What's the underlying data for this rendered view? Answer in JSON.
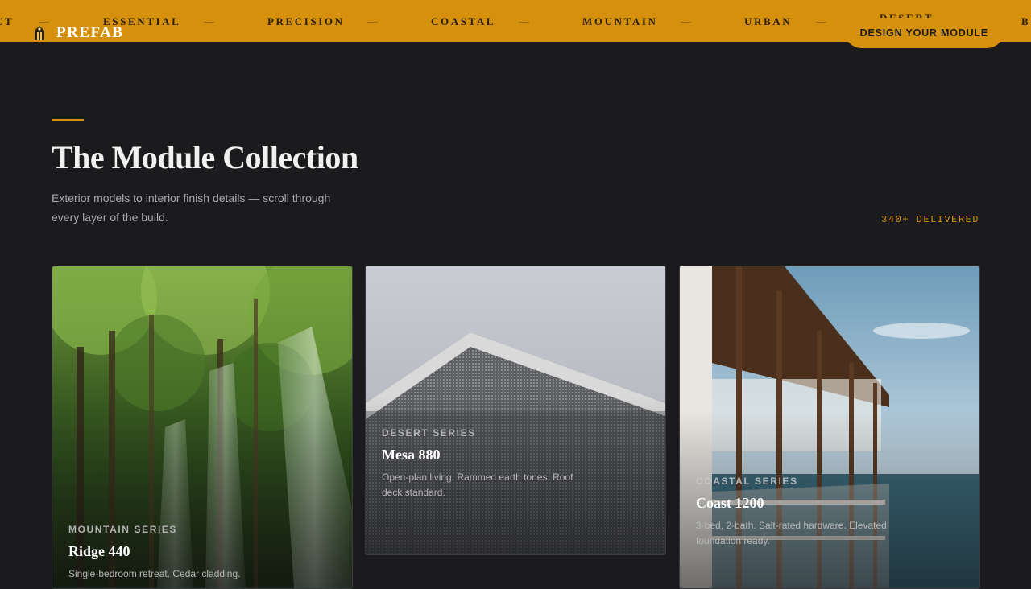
{
  "ticker": {
    "words": [
      "CT",
      "ESSENTIAL",
      "PRECISION",
      "COASTAL",
      "MOUNTAIN",
      "URBAN",
      "DESERT",
      "B"
    ],
    "separator": "—"
  },
  "brand": {
    "name": "PREFAB",
    "icon": "module-house-icon"
  },
  "cta": {
    "label": "DESIGN YOUR MODULE"
  },
  "section": {
    "title": "The Module Collection",
    "subtitle": "Exterior models to interior finish details — scroll through every layer of the build.",
    "delivered": "340+ DELIVERED"
  },
  "cards": [
    {
      "series": "MOUNTAIN SERIES",
      "name": "Ridge 440",
      "desc": "Single-bedroom retreat. Cedar cladding."
    },
    {
      "series": "DESERT SERIES",
      "name": "Mesa 880",
      "desc": "Open-plan living. Rammed earth tones. Roof deck standard."
    },
    {
      "series": "COASTAL SERIES",
      "name": "Coast 1200",
      "desc": "3-bed, 2-bath. Salt-rated hardware. Elevated foundation ready."
    }
  ],
  "colors": {
    "accent": "#d5910e",
    "background": "#1b1b1d"
  }
}
